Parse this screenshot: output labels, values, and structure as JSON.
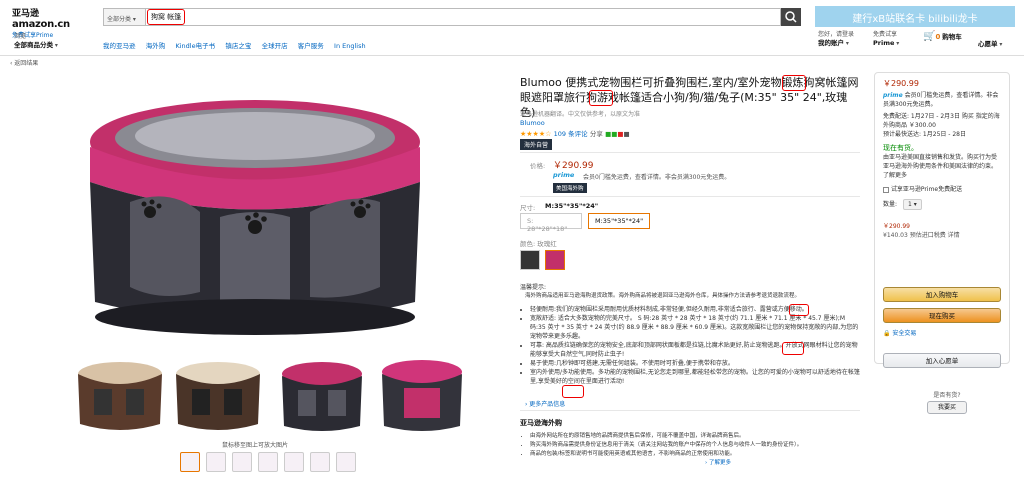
{
  "header": {
    "logo_cn": "亚马逊",
    "logo_en": "amazon.cn",
    "logo_prime": "免费试享Prime",
    "search_category": "全部分类",
    "search_query": "狗窝 帐篷",
    "promo_text": "建行xB站联名卡 bilibili龙卡",
    "deliver_line1": "浏览",
    "deliver_line2": "全部商品分类",
    "nav_links": [
      "我的亚马逊",
      "海外购",
      "Kindle电子书",
      "镇店之宝",
      "全球开店",
      "客户服务",
      "In English"
    ],
    "account_line1": "您好，请登录",
    "account_line2": "我的账户",
    "prime_line1": "免费试享",
    "prime_line2": "Prime",
    "cart_count": "0",
    "cart_label": "购物车",
    "wishlist_label": "心愿单"
  },
  "breadcrumb": "‹ 返回结果",
  "gallery": {
    "zoom_tip": "鼠标移至图上可放大图片"
  },
  "product": {
    "title": "Blumoo 便携式宠物围栏可折叠狗围栏,室内/室外宠物锻炼狗窝帐篷网眼遮阳罩旅行狗游戏帐篷适合小狗/狗/猫/兔子(M:35\" 35\" 24\",玫瑰色)",
    "ref_note": "亚马逊机器翻译。中文仅供参考，以原文为准",
    "brand": "Blumoo",
    "rating_stars": "★★★★☆",
    "rating_count": "109 条评论",
    "share": "分享",
    "overseas_badge": "海外自营",
    "price_label": "价格:",
    "price": "￥290.99",
    "prime_text": "prime",
    "prime_shipping": "会员0门槛免运费，查看详情。非会员满300元免运费。",
    "ship_badge": "美国海外购",
    "size_label": "尺寸:",
    "size_value": "M:35\"*35\"*24\"",
    "size_options": [
      "S: 28\"*28\"*18\"",
      "M:35\"*35\"*24\""
    ],
    "color_label": "颜色: 玫瑰红",
    "notice_label": "温馨提示:",
    "notice_text": "海外购商品适用亚马逊海购退货政策。海外购商品将被退回亚马逊海外仓库，具体操作方法请参考退货退款流程。",
    "bullets": [
      "轻便耐用:我们的宠物围栏采用耐用优质材料制成,非常轻便,但经久耐用,非常适合旅行、露营或方便移动。",
      "宽敞舒适: 适合大多数宠物的完美尺寸。 S 码:28 英寸 * 28 英寸 * 18 英寸(约 71.1 厘米 * 71.1 厘米 * 45.7 厘米);M 码:35 英寸 * 35 英寸 * 24 英寸(约 88.9 厘米 * 88.9 厘米 * 60.9 厘米)。这款宽敞围栏让您的宠物保持宽敞的内部,为您的宠物带来更多乐趣。",
      "可靠: 高品质拉链确保您的宠物安全,底部和顶部网状面板都是拉链,比魔术贴更好,防止宠物逃跑。开放式网眼材料让您的宠物能够享受大自然空气,同时防止虫子!",
      "易于使用:几秒钟即可搭建,无需任何组装。不使用时可折叠,便于携带和存放。",
      "室内外使用/多功能使用。多功能的宠物围栏,无论您走到哪里,都能轻松带您的宠物。让您的可爱的小宠物可以舒适地待在帐篷里,享受美好的空间在里面进行活动!"
    ],
    "more_details": "› 更多产品信息",
    "overseas_title": "亚马逊海外购",
    "overseas_items": [
      "由海外网站所在的原销售地的品牌商提供售后保修，可能不覆盖中国，详询品牌商售后。",
      "购买海外购商品需提供身份证信息用于清关（请关注网站我的账户中保存的个人信息与收件人一致的身份证件）。",
      "商品的包装/标签和说明书可能使用英语或其他语言，不影响商品的正常使用和功能。"
    ],
    "overseas_more": "› 了解更多"
  },
  "buybox": {
    "price": "￥290.99",
    "prime_text": "prime",
    "prime_note": "会员0门槛免运费，查看详情。非会员满300元免运费。",
    "delivery_line": "免费配送: 1月27日 - 2月3日 购买 指定的海外购商品 ￥300.00",
    "fastest": "预计最快送达: 1月25日 - 28日",
    "stock": "现在有货。",
    "seller_note": "由亚马逊美国直接销售和发货。购买行为受亚马逊海外购使用条件和美国法律的约束。了解更多",
    "trial": "试享亚马逊Prime免费配送",
    "qty_label": "数量:",
    "qty_value": "1",
    "summary_price": "￥290.99",
    "summary_tax": "¥140.03 预估进口税费 详情",
    "add_to_cart": "加入购物车",
    "buy_now": "现在购买",
    "secure": "安全交易",
    "add_to_wishlist": "加入心愿单",
    "sell_question": "是否有货?",
    "sell_button": "我要买"
  }
}
